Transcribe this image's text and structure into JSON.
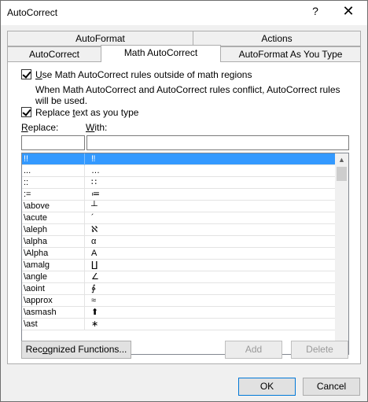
{
  "window": {
    "title": "AutoCorrect",
    "help": "?",
    "close": "✕"
  },
  "tabs_top": [
    {
      "label": "AutoFormat"
    },
    {
      "label": "Actions"
    }
  ],
  "tabs_bottom": [
    {
      "label": "AutoCorrect"
    },
    {
      "label": "Math AutoCorrect",
      "selected": true
    },
    {
      "label": "AutoFormat As You Type"
    }
  ],
  "options": {
    "use_outside": {
      "pre": "",
      "key": "U",
      "post": "se Math AutoCorrect rules outside of math regions",
      "checked": true
    },
    "note": "When Math AutoCorrect and AutoCorrect rules conflict, AutoCorrect rules will be used.",
    "replace_as_type": {
      "pre": "Replace ",
      "key": "t",
      "post": "ext as you type",
      "checked": true
    }
  },
  "columns": {
    "replace": {
      "key": "R",
      "rest": "eplace:"
    },
    "with": {
      "key": "W",
      "rest": "ith:"
    }
  },
  "inputs": {
    "replace_value": "",
    "with_value": ""
  },
  "rows": [
    {
      "replace": "!!",
      "with": "‼",
      "selected": true
    },
    {
      "replace": "...",
      "with": "…"
    },
    {
      "replace": "::",
      "with": "∷"
    },
    {
      "replace": ":=",
      "with": "≔"
    },
    {
      "replace": "\\above",
      "with": "┴"
    },
    {
      "replace": "\\acute",
      "with": "´"
    },
    {
      "replace": "\\aleph",
      "with": "ℵ"
    },
    {
      "replace": "\\alpha",
      "with": "α"
    },
    {
      "replace": "\\Alpha",
      "with": "A"
    },
    {
      "replace": "\\amalg",
      "with": "∐"
    },
    {
      "replace": "\\angle",
      "with": "∠"
    },
    {
      "replace": "\\aoint",
      "with": "∳"
    },
    {
      "replace": "\\approx",
      "with": "≈"
    },
    {
      "replace": "\\asmash",
      "with": "⬆"
    },
    {
      "replace": "\\ast",
      "with": "∗"
    }
  ],
  "buttons": {
    "recognized": {
      "pre": "Rec",
      "key": "o",
      "post": "gnized Functions..."
    },
    "add": "Add",
    "delete": "Delete",
    "ok": "OK",
    "cancel": "Cancel"
  }
}
